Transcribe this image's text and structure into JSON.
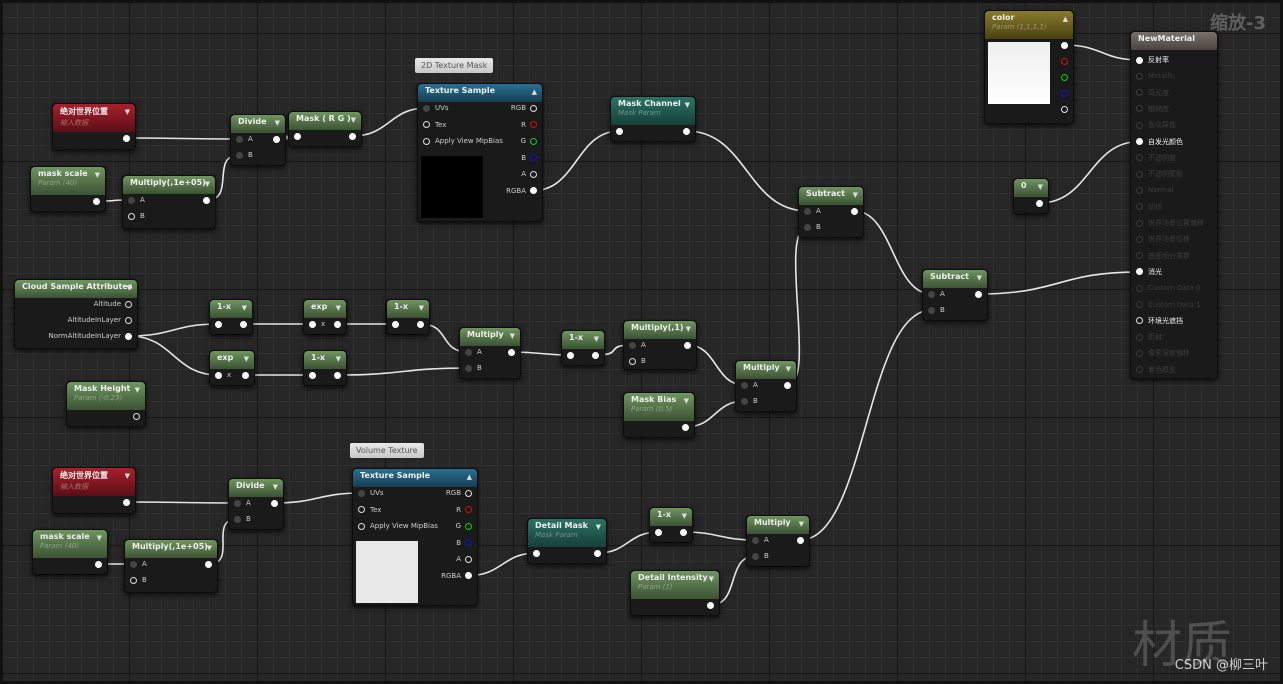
{
  "zoom_label": "缩放-3",
  "watermark": "材质",
  "credit": "CSDN @柳三叶",
  "comments": [
    {
      "id": "c1",
      "text": "2D Texture Mask"
    },
    {
      "id": "c2",
      "text": "Volume Texture"
    }
  ],
  "nodes": [
    {
      "id": "abs1",
      "title": "绝对世界位置",
      "subtitle": "输入数据",
      "style": "red",
      "outputs": [
        {
          "label": "",
          "state": "filled"
        }
      ]
    },
    {
      "id": "ms1",
      "title": "mask scale",
      "subtitle": "Param (40)",
      "style": "green",
      "outputs": [
        {
          "label": "",
          "state": "filled"
        }
      ]
    },
    {
      "id": "mul1",
      "title": "Multiply(,1e+05)",
      "style": "green",
      "inputs": [
        {
          "label": "A",
          "state": "dim"
        },
        {
          "label": "B",
          "state": "hollow"
        }
      ],
      "outputs": [
        {
          "label": "",
          "state": "filled"
        }
      ]
    },
    {
      "id": "div1",
      "title": "Divide",
      "style": "green",
      "inputs": [
        {
          "label": "A",
          "state": "dim"
        },
        {
          "label": "B",
          "state": "dim"
        }
      ],
      "outputs": [
        {
          "label": "",
          "state": "filled"
        }
      ]
    },
    {
      "id": "maskrg",
      "title": "Mask ( R G )",
      "style": "green",
      "inputs": [
        {
          "label": "",
          "state": "filled"
        }
      ],
      "outputs": [
        {
          "label": "",
          "state": "filled"
        }
      ]
    },
    {
      "id": "ts1",
      "title": "Texture Sample",
      "style": "blue",
      "collapse": "▲",
      "preview": "#000000",
      "inputs": [
        {
          "label": "UVs",
          "state": "dim"
        },
        {
          "label": "Tex",
          "state": "hollow"
        },
        {
          "label": "Apply View MipBias",
          "state": "hollow"
        }
      ],
      "outputs": [
        {
          "label": "RGB",
          "state": "hollow"
        },
        {
          "label": "R",
          "state": "hollow",
          "color": "#d01010"
        },
        {
          "label": "G",
          "state": "hollow",
          "color": "#10d010"
        },
        {
          "label": "B",
          "state": "hollow",
          "color": "#1010d0"
        },
        {
          "label": "A",
          "state": "hollow"
        },
        {
          "label": "RGBA",
          "state": "filled"
        }
      ]
    },
    {
      "id": "mc",
      "title": "Mask Channel",
      "subtitle": "Mask Param",
      "style": "teal",
      "inputs": [
        {
          "label": "",
          "state": "filled"
        }
      ],
      "outputs": [
        {
          "label": "",
          "state": "filled"
        }
      ]
    },
    {
      "id": "sub1",
      "title": "Subtract",
      "style": "green",
      "inputs": [
        {
          "label": "A",
          "state": "dim"
        },
        {
          "label": "B",
          "state": "dim"
        }
      ],
      "outputs": [
        {
          "label": "",
          "state": "filled"
        }
      ]
    },
    {
      "id": "sub2",
      "title": "Subtract",
      "style": "green",
      "inputs": [
        {
          "label": "A",
          "state": "dim"
        },
        {
          "label": "B",
          "state": "dim"
        }
      ],
      "outputs": [
        {
          "label": "",
          "state": "filled"
        }
      ]
    },
    {
      "id": "color",
      "title": "color",
      "subtitle": "Param (1,1,1,1)",
      "style": "gold",
      "collapse": "▲",
      "preview": "#ffffff",
      "outputs": [
        {
          "label": "",
          "state": "filled"
        },
        {
          "label": "",
          "state": "hollow",
          "color": "#d01010"
        },
        {
          "label": "",
          "state": "hollow",
          "color": "#10d010"
        },
        {
          "label": "",
          "state": "hollow",
          "color": "#1010d0"
        },
        {
          "label": "",
          "state": "hollow"
        }
      ]
    },
    {
      "id": "zero",
      "title": "0",
      "style": "green",
      "outputs": [
        {
          "label": "",
          "state": "filled"
        }
      ]
    },
    {
      "id": "nm",
      "title": "NewMaterial",
      "style": "mat",
      "nocollapse": true,
      "inputs": [
        {
          "label": "反射率",
          "state": "filled",
          "active": true
        },
        {
          "label": "Metallic",
          "state": "faint"
        },
        {
          "label": "高光度",
          "state": "faint"
        },
        {
          "label": "粗糙度",
          "state": "faint"
        },
        {
          "label": "各向异性",
          "state": "faint"
        },
        {
          "label": "自发光颜色",
          "state": "filled",
          "active": true
        },
        {
          "label": "不透明度",
          "state": "faint"
        },
        {
          "label": "不透明蒙版",
          "state": "faint"
        },
        {
          "label": "Normal",
          "state": "faint"
        },
        {
          "label": "切线",
          "state": "faint"
        },
        {
          "label": "世界场景位置偏移",
          "state": "faint"
        },
        {
          "label": "世界场景位移",
          "state": "faint"
        },
        {
          "label": "曲面细分乘数",
          "state": "faint"
        },
        {
          "label": "消光",
          "state": "filled",
          "active": true
        },
        {
          "label": "Custom Data 0",
          "state": "faint"
        },
        {
          "label": "Custom Data 1",
          "state": "faint"
        },
        {
          "label": "环境光遮挡",
          "state": "hollow",
          "active": true
        },
        {
          "label": "折射",
          "state": "faint"
        },
        {
          "label": "像素深度偏移",
          "state": "faint"
        },
        {
          "label": "着色模型",
          "state": "faint"
        }
      ]
    },
    {
      "id": "csa",
      "title": "Cloud Sample Attributes",
      "style": "green",
      "outputs": [
        {
          "label": "Altitude",
          "state": "hollow"
        },
        {
          "label": "AltitudeInLayer",
          "state": "hollow"
        },
        {
          "label": "NormAltitudeInLayer",
          "state": "filled"
        }
      ]
    },
    {
      "id": "onex1",
      "title": "1-x",
      "style": "green",
      "inputs": [
        {
          "label": "",
          "state": "filled"
        }
      ],
      "outputs": [
        {
          "label": "",
          "state": "filled"
        }
      ]
    },
    {
      "id": "exp1",
      "title": "exp",
      "style": "green",
      "inputs": [
        {
          "label": "x",
          "state": "filled"
        }
      ],
      "outputs": [
        {
          "label": "",
          "state": "filled"
        }
      ]
    },
    {
      "id": "onex2",
      "title": "1-x",
      "style": "green",
      "inputs": [
        {
          "label": "",
          "state": "filled"
        }
      ],
      "outputs": [
        {
          "label": "",
          "state": "filled"
        }
      ]
    },
    {
      "id": "exp2",
      "title": "exp",
      "style": "green",
      "inputs": [
        {
          "label": "x",
          "state": "filled"
        }
      ],
      "outputs": [
        {
          "label": "",
          "state": "filled"
        }
      ]
    },
    {
      "id": "onex3",
      "title": "1-x",
      "style": "green",
      "inputs": [
        {
          "label": "",
          "state": "filled"
        }
      ],
      "outputs": [
        {
          "label": "",
          "state": "filled"
        }
      ]
    },
    {
      "id": "mul2",
      "title": "Multiply",
      "style": "green",
      "inputs": [
        {
          "label": "A",
          "state": "dim"
        },
        {
          "label": "B",
          "state": "dim"
        }
      ],
      "outputs": [
        {
          "label": "",
          "state": "filled"
        }
      ]
    },
    {
      "id": "onex4",
      "title": "1-x",
      "style": "green",
      "inputs": [
        {
          "label": "",
          "state": "filled"
        }
      ],
      "outputs": [
        {
          "label": "",
          "state": "filled"
        }
      ]
    },
    {
      "id": "mul3",
      "title": "Multiply(,1)",
      "style": "green",
      "inputs": [
        {
          "label": "A",
          "state": "dim"
        },
        {
          "label": "B",
          "state": "hollow"
        }
      ],
      "outputs": [
        {
          "label": "",
          "state": "filled"
        }
      ]
    },
    {
      "id": "mul4",
      "title": "Multiply",
      "style": "green",
      "inputs": [
        {
          "label": "A",
          "state": "dim"
        },
        {
          "label": "B",
          "state": "dim"
        }
      ],
      "outputs": [
        {
          "label": "",
          "state": "filled"
        }
      ]
    },
    {
      "id": "mh",
      "title": "Mask Height",
      "subtitle": "Param (-0.23)",
      "style": "green",
      "outputs": [
        {
          "label": "",
          "state": "hollow"
        }
      ]
    },
    {
      "id": "mb",
      "title": "Mask Bias",
      "subtitle": "Param (0.5)",
      "style": "green",
      "outputs": [
        {
          "label": "",
          "state": "filled"
        }
      ]
    },
    {
      "id": "abs2",
      "title": "绝对世界位置",
      "subtitle": "输入数据",
      "style": "red",
      "outputs": [
        {
          "label": "",
          "state": "filled"
        }
      ]
    },
    {
      "id": "ms2",
      "title": "mask scale",
      "subtitle": "Param (40)",
      "style": "green",
      "outputs": [
        {
          "label": "",
          "state": "filled"
        }
      ]
    },
    {
      "id": "mul5",
      "title": "Multiply(,1e+05)",
      "style": "green",
      "inputs": [
        {
          "label": "A",
          "state": "dim"
        },
        {
          "label": "B",
          "state": "hollow"
        }
      ],
      "outputs": [
        {
          "label": "",
          "state": "filled"
        }
      ]
    },
    {
      "id": "div2",
      "title": "Divide",
      "style": "green",
      "inputs": [
        {
          "label": "A",
          "state": "dim"
        },
        {
          "label": "B",
          "state": "dim"
        }
      ],
      "outputs": [
        {
          "label": "",
          "state": "filled"
        }
      ]
    },
    {
      "id": "ts2",
      "title": "Texture Sample",
      "style": "blue",
      "collapse": "▲",
      "preview": "#e8e8e8",
      "inputs": [
        {
          "label": "UVs",
          "state": "dim"
        },
        {
          "label": "Tex",
          "state": "hollow"
        },
        {
          "label": "Apply View MipBias",
          "state": "hollow"
        }
      ],
      "outputs": [
        {
          "label": "RGB",
          "state": "hollow"
        },
        {
          "label": "R",
          "state": "hollow",
          "color": "#d01010"
        },
        {
          "label": "G",
          "state": "hollow",
          "color": "#10d010"
        },
        {
          "label": "B",
          "state": "hollow",
          "color": "#1010d0"
        },
        {
          "label": "A",
          "state": "hollow"
        },
        {
          "label": "RGBA",
          "state": "filled"
        }
      ]
    },
    {
      "id": "dm",
      "title": "Detail Mask",
      "subtitle": "Mask Param",
      "style": "teal",
      "inputs": [
        {
          "label": "",
          "state": "filled"
        }
      ],
      "outputs": [
        {
          "label": "",
          "state": "filled"
        }
      ]
    },
    {
      "id": "onex5",
      "title": "1-x",
      "style": "green",
      "inputs": [
        {
          "label": "",
          "state": "filled"
        }
      ],
      "outputs": [
        {
          "label": "",
          "state": "filled"
        }
      ]
    },
    {
      "id": "mul6",
      "title": "Multiply",
      "style": "green",
      "inputs": [
        {
          "label": "A",
          "state": "dim"
        },
        {
          "label": "B",
          "state": "dim"
        }
      ],
      "outputs": [
        {
          "label": "",
          "state": "filled"
        }
      ]
    },
    {
      "id": "di",
      "title": "Detail Intensity",
      "subtitle": "Param (1)",
      "style": "green",
      "outputs": [
        {
          "label": "",
          "state": "filled"
        }
      ]
    }
  ],
  "connections": [
    [
      "abs1.o0",
      "div1.i0"
    ],
    [
      "ms1.o0",
      "mul1.i0"
    ],
    [
      "mul1.o0",
      "div1.i1"
    ],
    [
      "div1.o0",
      "maskrg.i0"
    ],
    [
      "maskrg.o0",
      "ts1.i0"
    ],
    [
      "ts1.o5",
      "mc.i0"
    ],
    [
      "mc.o0",
      "sub1.i0"
    ],
    [
      "mul4.o0",
      "sub1.i1"
    ],
    [
      "sub1.o0",
      "sub2.i0"
    ],
    [
      "mul6.o0",
      "sub2.i1"
    ],
    [
      "sub2.o0",
      "nm.i13"
    ],
    [
      "color.o0",
      "nm.i0"
    ],
    [
      "zero.o0",
      "nm.i5"
    ],
    [
      "csa.o2",
      "onex1.i0"
    ],
    [
      "csa.o2",
      "exp2.i0"
    ],
    [
      "onex1.o0",
      "exp1.i0"
    ],
    [
      "exp1.o0",
      "onex2.i0"
    ],
    [
      "onex2.o0",
      "mul2.i0"
    ],
    [
      "exp2.o0",
      "onex3.i0"
    ],
    [
      "onex3.o0",
      "mul2.i1"
    ],
    [
      "mul2.o0",
      "onex4.i0"
    ],
    [
      "onex4.o0",
      "mul3.i0"
    ],
    [
      "mul3.o0",
      "mul4.i0"
    ],
    [
      "mb.o0",
      "mul4.i1"
    ],
    [
      "abs2.o0",
      "div2.i0"
    ],
    [
      "ms2.o0",
      "mul5.i0"
    ],
    [
      "mul5.o0",
      "div2.i1"
    ],
    [
      "div2.o0",
      "ts2.i0"
    ],
    [
      "ts2.o5",
      "dm.i0"
    ],
    [
      "dm.o0",
      "onex5.i0"
    ],
    [
      "onex5.o0",
      "mul6.i0"
    ],
    [
      "di.o0",
      "mul6.i1"
    ]
  ]
}
